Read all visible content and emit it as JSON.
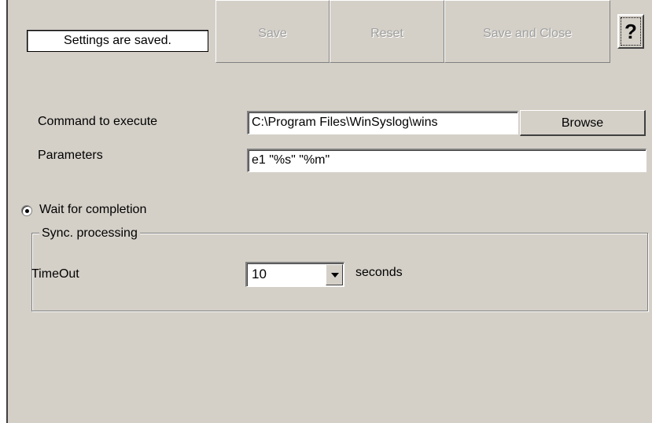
{
  "status": {
    "text": "Settings are saved."
  },
  "toolbar": {
    "save_label": "Save",
    "reset_label": "Reset",
    "save_close_label": "Save and Close",
    "help_label": "?"
  },
  "command": {
    "label": "Command to execute",
    "value": "C:\\Program Files\\WinSyslog\\wins",
    "browse_label": "Browse"
  },
  "parameters": {
    "label": "Parameters",
    "value": "e1 \"%s\" \"%m\""
  },
  "wait": {
    "label": "Wait for completion",
    "checked": true
  },
  "sync": {
    "legend": "Sync. processing",
    "timeout_label": "TimeOut",
    "timeout_value": "10",
    "unit_label": "seconds"
  },
  "icons": {
    "dropdown": "chevron-down-icon",
    "help": "help-icon"
  },
  "colors": {
    "panel": "#d4d0c8",
    "disabled_text": "#a0a0a0"
  }
}
